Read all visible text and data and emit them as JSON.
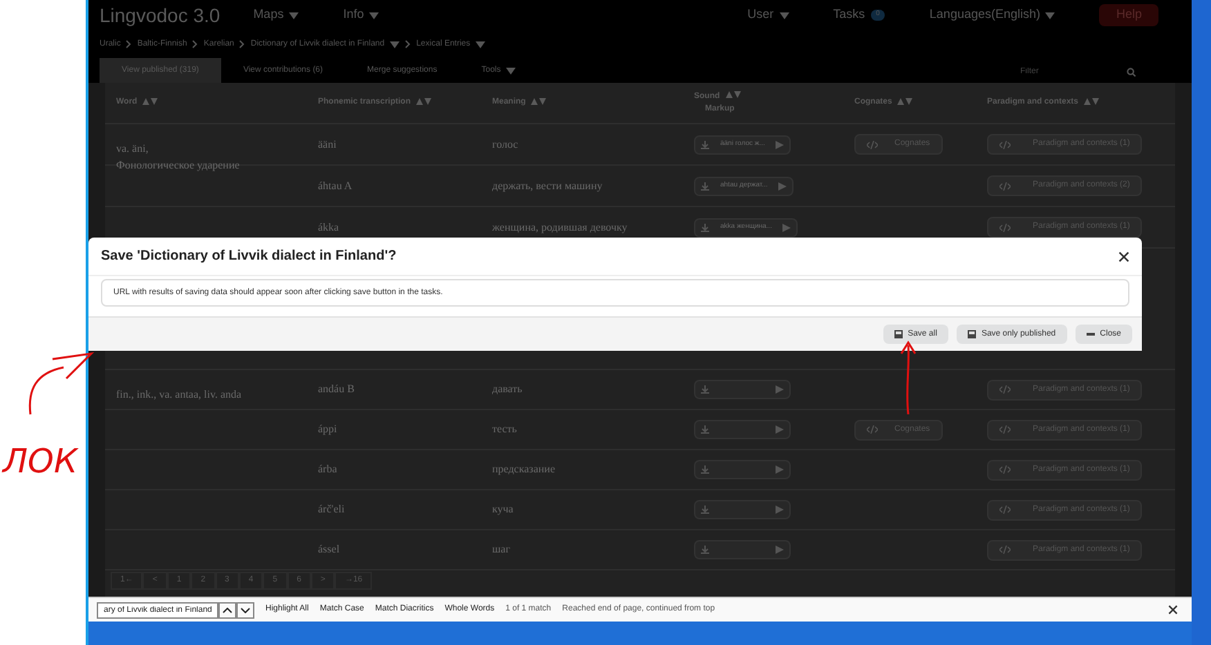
{
  "nav": {
    "brand": "Lingvodoc 3.0",
    "left": [
      {
        "label": "Maps"
      },
      {
        "label": "Info"
      }
    ],
    "user": "User",
    "tasks": {
      "label": "Tasks",
      "count": "0"
    },
    "language": "Languages(English)",
    "help": "Help"
  },
  "breadcrumbs": [
    {
      "label": "Uralic",
      "dropdown": false
    },
    {
      "label": "Baltic-Finnish",
      "dropdown": false
    },
    {
      "label": "Karelian",
      "dropdown": false
    },
    {
      "label": "Dictionary of Livvik dialect in Finland",
      "dropdown": true
    },
    {
      "label": "Lexical Entries",
      "dropdown": true
    }
  ],
  "tabs": [
    {
      "label": "View published (319)",
      "selected": true,
      "dropdown": false
    },
    {
      "label": "View contributions (6)",
      "selected": false,
      "dropdown": false
    },
    {
      "label": "Merge suggestions",
      "selected": false,
      "dropdown": false
    },
    {
      "label": "Tools",
      "selected": false,
      "dropdown": true
    }
  ],
  "filter": {
    "placeholder": "Filter"
  },
  "table": {
    "columns": [
      "Word",
      "Phonemic transcription",
      "Meaning",
      "Sound",
      "Cognates",
      "Paradigm and contexts"
    ],
    "sound_sub": "Markup",
    "rows_top": [
      {
        "word": [
          "va. äni,",
          "Фонологическое ударение"
        ],
        "transcription": "ääni",
        "meaning": "голос",
        "sound": "ääni голос ж...",
        "cognates": "Cognates",
        "paradigm": "Paradigm and contexts (1)"
      },
      {
        "transcription": "áhtau A",
        "meaning": "держать, вести машину",
        "sound": "ahtau держат...",
        "paradigm": "Paradigm and contexts (2)"
      },
      {
        "transcription": "ákka",
        "meaning": "женщина, родившая девочку",
        "sound": "akka женщина...",
        "paradigm": "Paradigm and contexts (1)"
      }
    ],
    "rows_bottom": [
      {
        "word": [
          "fin., ink., va. antaa, liv. anda"
        ],
        "transcription": "andáu B",
        "meaning": "давать",
        "paradigm": "Paradigm and contexts (1)"
      },
      {
        "transcription": "áppi",
        "meaning": "тесть",
        "cognates": "Cognates",
        "paradigm": "Paradigm and contexts (1)"
      },
      {
        "transcription": "árba",
        "meaning": "предсказание",
        "paradigm": "Paradigm and contexts (1)"
      },
      {
        "transcription": "árč'eli",
        "meaning": "куча",
        "paradigm": "Paradigm and contexts (1)"
      },
      {
        "transcription": "ássel",
        "meaning": "шаг",
        "paradigm": "Paradigm and contexts (1)"
      }
    ]
  },
  "pagination": [
    {
      "label": "1←"
    },
    {
      "label": "<"
    },
    {
      "label": "1"
    },
    {
      "label": "2"
    },
    {
      "label": "3"
    },
    {
      "label": "4"
    },
    {
      "label": "5"
    },
    {
      "label": "6"
    },
    {
      "label": ">"
    },
    {
      "label": "→16"
    }
  ],
  "dialog": {
    "title": "Save 'Dictionary of Livvik dialect in Finland'?",
    "message": "URL with results of saving data should appear soon after clicking save button in the tasks.",
    "buttons": [
      {
        "label": "Save all",
        "kind": "save"
      },
      {
        "label": "Save only published",
        "kind": "save"
      },
      {
        "label": "Close",
        "kind": "close"
      }
    ]
  },
  "find_bar": {
    "value": "ary of Livvik dialect in Finland",
    "options": [
      "Highlight All",
      "Match Case",
      "Match Diacritics",
      "Whole Words"
    ],
    "count": "1 of 1 match",
    "status": "Reached end of page, continued from top"
  },
  "annotation": {
    "text": "ЛОК"
  }
}
